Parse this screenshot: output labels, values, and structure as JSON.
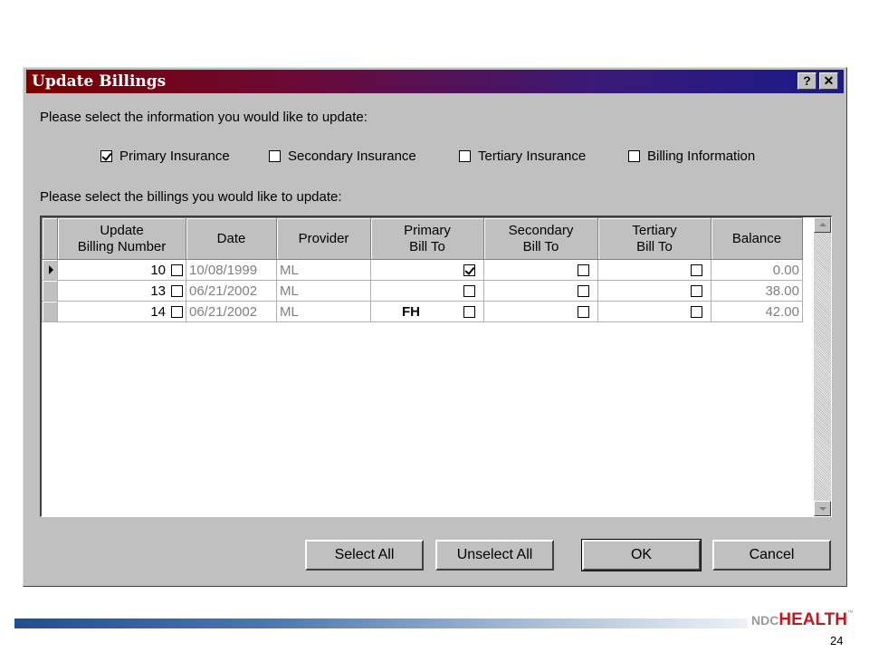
{
  "window": {
    "title": "Update Billings",
    "help_label": "?",
    "close_label": "✕"
  },
  "info_prompt": "Please select the information you would like to update:",
  "options": [
    {
      "label": "Primary Insurance",
      "checked": true
    },
    {
      "label": "Secondary Insurance",
      "checked": false
    },
    {
      "label": "Tertiary Insurance",
      "checked": false
    },
    {
      "label": "Billing Information",
      "checked": false
    }
  ],
  "billings_prompt": "Please select the billings you would like to update:",
  "table": {
    "headers": {
      "update": [
        "Update",
        "Billing Number"
      ],
      "date": "Date",
      "provider": "Provider",
      "primary": [
        "Primary",
        "Bill To"
      ],
      "secondary": [
        "Secondary",
        "Bill To"
      ],
      "tertiary": [
        "Tertiary",
        "Bill To"
      ],
      "balance": "Balance"
    },
    "rows": [
      {
        "number": "10",
        "update_checked": false,
        "date": "10/08/1999",
        "provider": "ML",
        "primary_text": "",
        "primary_checked": true,
        "secondary_checked": false,
        "tertiary_checked": false,
        "balance": "0.00",
        "current": true
      },
      {
        "number": "13",
        "update_checked": false,
        "date": "06/21/2002",
        "provider": "ML",
        "primary_text": "",
        "primary_checked": false,
        "secondary_checked": false,
        "tertiary_checked": false,
        "balance": "38.00",
        "current": false
      },
      {
        "number": "14",
        "update_checked": false,
        "date": "06/21/2002",
        "provider": "ML",
        "primary_text": "FH",
        "primary_checked": false,
        "secondary_checked": false,
        "tertiary_checked": false,
        "balance": "42.00",
        "current": false
      }
    ]
  },
  "buttons": {
    "select_all": "Select All",
    "unselect_all": "Unselect All",
    "ok": "OK",
    "cancel": "Cancel"
  },
  "footer": {
    "logo_prefix": "NDC",
    "logo_main": "HEALTH",
    "logo_tm": "™",
    "page_number": "24"
  },
  "colors": {
    "dialog_face": "#c0c0c0",
    "title_gradient_start": "#7a0000",
    "title_gradient_end": "#1a1a8a",
    "logo_red": "#c0191f",
    "footer_bar_blue": "#1f4f8f"
  }
}
